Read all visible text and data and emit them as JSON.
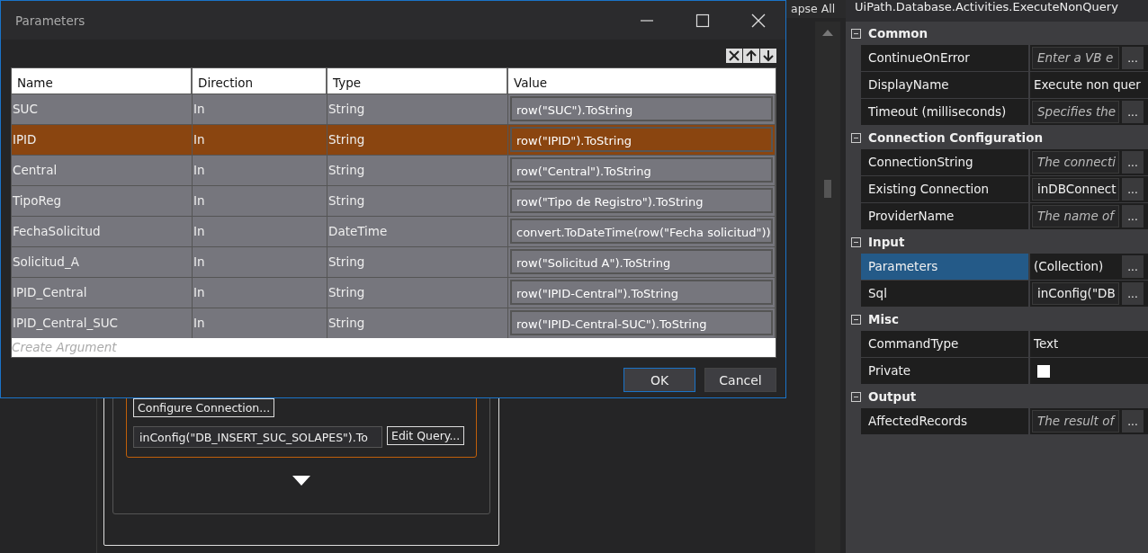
{
  "background": {
    "toolbar_text": "apse All",
    "configure_button": "Configure Connection...",
    "sql_field": "inConfig(\"DB_INSERT_SUC_SOLAPES\").To",
    "edit_button": "Edit Query..."
  },
  "dialog": {
    "title": "Parameters",
    "columns": [
      "Name",
      "Direction",
      "Type",
      "Value"
    ],
    "rows": [
      {
        "name": "SUC",
        "direction": "In",
        "type": "String",
        "value": "row(\"SUC\").ToString",
        "selected": false
      },
      {
        "name": "IPID",
        "direction": "In",
        "type": "String",
        "value": "row(\"IPID\").ToString",
        "selected": true
      },
      {
        "name": "Central",
        "direction": "In",
        "type": "String",
        "value": "row(\"Central\").ToString",
        "selected": false
      },
      {
        "name": "TipoReg",
        "direction": "In",
        "type": "String",
        "value": "row(\"Tipo de Registro\").ToString",
        "selected": false
      },
      {
        "name": "FechaSolicitud",
        "direction": "In",
        "type": "DateTime",
        "value": "convert.ToDateTime(row(\"Fecha solicitud\"))",
        "selected": false
      },
      {
        "name": "Solicitud_A",
        "direction": "In",
        "type": "String",
        "value": "row(\"Solicitud A\").ToString",
        "selected": false
      },
      {
        "name": "IPID_Central",
        "direction": "In",
        "type": "String",
        "value": "row(\"IPID-Central\").ToString",
        "selected": false
      },
      {
        "name": "IPID_Central_SUC",
        "direction": "In",
        "type": "String",
        "value": "row(\"IPID-Central-SUC\").ToString",
        "selected": false
      }
    ],
    "create_placeholder": "Create Argument",
    "buttons": [
      "OK",
      "Cancel"
    ]
  },
  "properties": {
    "title": "UiPath.Database.Activities.ExecuteNonQuery",
    "groups": [
      {
        "name": "Common",
        "expanded": true,
        "items": [
          {
            "label": "ContinueOnError",
            "kind": "expr",
            "placeholder": "Enter a VB e",
            "button": "...",
            "selected": false
          },
          {
            "label": "DisplayName",
            "kind": "text",
            "value": "Execute non quer",
            "selected": false
          },
          {
            "label": "Timeout (milliseconds)",
            "kind": "expr",
            "placeholder": "Specifies the",
            "button": "...",
            "selected": false
          }
        ]
      },
      {
        "name": "Connection Configuration",
        "expanded": true,
        "items": [
          {
            "label": "ConnectionString",
            "kind": "expr",
            "placeholder": "The connecti",
            "button": "...",
            "selected": false
          },
          {
            "label": "Existing Connection",
            "kind": "expr",
            "value": "inDBConnect",
            "button": "...",
            "selected": false
          },
          {
            "label": "ProviderName",
            "kind": "expr",
            "placeholder": "The name of",
            "button": "...",
            "selected": false
          }
        ]
      },
      {
        "name": "Input",
        "expanded": true,
        "items": [
          {
            "label": "Parameters",
            "kind": "collection",
            "value": "(Collection)",
            "button": "...",
            "selected": true
          },
          {
            "label": "Sql",
            "kind": "expr",
            "value": "inConfig(\"DB",
            "button": "...",
            "selected": false
          }
        ]
      },
      {
        "name": "Misc",
        "expanded": true,
        "items": [
          {
            "label": "CommandType",
            "kind": "text",
            "value": "Text",
            "selected": false
          },
          {
            "label": "Private",
            "kind": "check",
            "checked": false,
            "selected": false
          }
        ]
      },
      {
        "name": "Output",
        "expanded": true,
        "items": [
          {
            "label": "AffectedRecords",
            "kind": "expr",
            "placeholder": "The result of",
            "button": "...",
            "selected": false
          }
        ]
      }
    ]
  }
}
